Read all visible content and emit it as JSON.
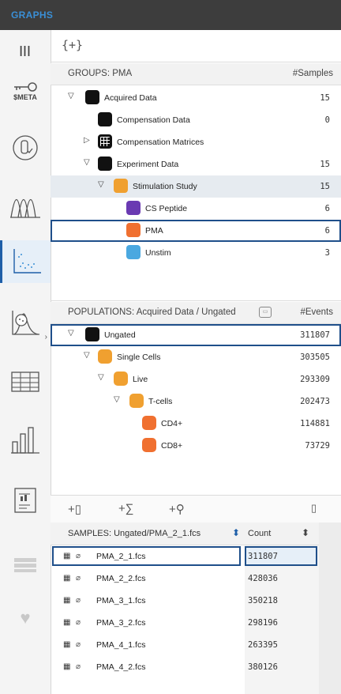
{
  "app": {
    "title": "GRAPHS"
  },
  "rail": {
    "meta_label": "$META"
  },
  "toolbar_top": {
    "brace_label": "{+}"
  },
  "groups": {
    "header_label": "GROUPS: PMA",
    "count_header": "#Samples",
    "items": [
      {
        "name": "Acquired Data",
        "count": "15",
        "level": 0,
        "toggle": "▽",
        "color": "#111111"
      },
      {
        "name": "Compensation Data",
        "count": "0",
        "level": 1,
        "toggle": "",
        "color": "#111111"
      },
      {
        "name": "Compensation Matrices",
        "count": "",
        "level": 1,
        "toggle": "▷",
        "color": "#111111"
      },
      {
        "name": "Experiment Data",
        "count": "15",
        "level": 1,
        "toggle": "▽",
        "color": "#111111"
      },
      {
        "name": "Stimulation Study",
        "count": "15",
        "level": 2,
        "toggle": "▽",
        "color": "#f0a030"
      },
      {
        "name": "CS Peptide",
        "count": "6",
        "level": 3,
        "toggle": "",
        "color": "#6a3ab2"
      },
      {
        "name": "PMA",
        "count": "6",
        "level": 3,
        "toggle": "",
        "color": "#f07030"
      },
      {
        "name": "Unstim",
        "count": "3",
        "level": 3,
        "toggle": "",
        "color": "#4aa8e0"
      }
    ]
  },
  "populations": {
    "header_label": "POPULATIONS: Acquired Data / Ungated",
    "count_header": "#Events",
    "items": [
      {
        "name": "Ungated",
        "count": "311807",
        "level": 0,
        "toggle": "▽"
      },
      {
        "name": "Single Cells",
        "count": "303505",
        "level": 1,
        "toggle": "▽"
      },
      {
        "name": "Live",
        "count": "293309",
        "level": 2,
        "toggle": "▽"
      },
      {
        "name": "T-cells",
        "count": "202473",
        "level": 3,
        "toggle": "▽"
      },
      {
        "name": "CD4+",
        "count": "114881",
        "level": 4,
        "toggle": ""
      },
      {
        "name": "CD8+",
        "count": "73729",
        "level": 4,
        "toggle": ""
      }
    ]
  },
  "actions": {
    "add_sample": "+▯",
    "add_stat": "+∑",
    "add_key": "+⚲",
    "delete": "▯"
  },
  "samples": {
    "header_label": "SAMPLES: Ungated/PMA_2_1.fcs",
    "count_header": "Count",
    "items": [
      {
        "name": "PMA_2_1.fcs",
        "count": "311807"
      },
      {
        "name": "PMA_2_2.fcs",
        "count": "428036"
      },
      {
        "name": "PMA_3_1.fcs",
        "count": "350218"
      },
      {
        "name": "PMA_3_2.fcs",
        "count": "298196"
      },
      {
        "name": "PMA_4_1.fcs",
        "count": "263395"
      },
      {
        "name": "PMA_4_2.fcs",
        "count": "380126"
      }
    ]
  }
}
